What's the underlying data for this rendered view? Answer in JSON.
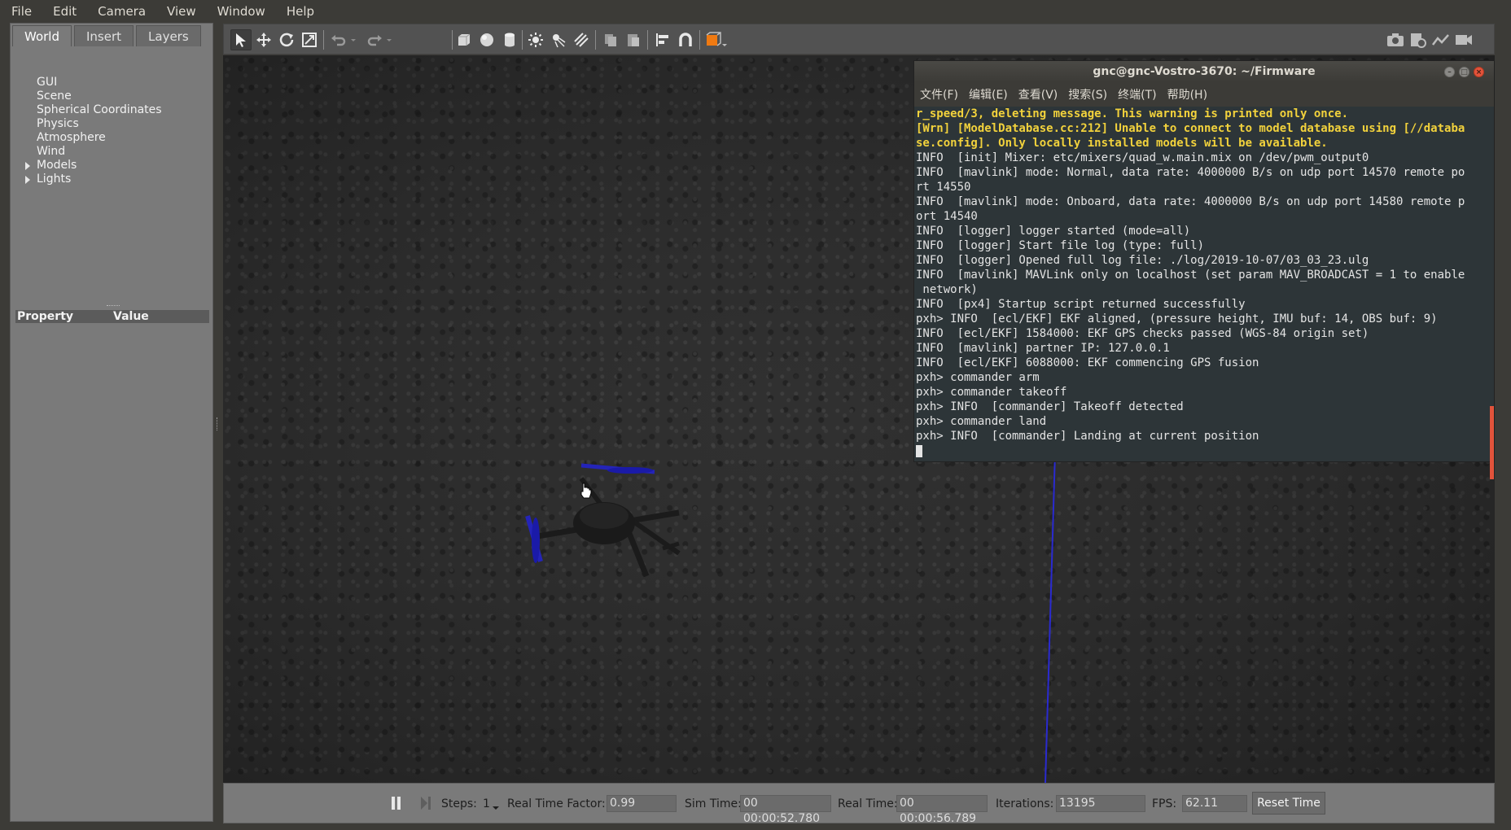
{
  "menubar": {
    "items": [
      "File",
      "Edit",
      "Camera",
      "View",
      "Window",
      "Help"
    ]
  },
  "left_panel": {
    "tabs": [
      "World",
      "Insert",
      "Layers"
    ],
    "active_tab": "World",
    "tree": [
      {
        "label": "GUI",
        "expandable": false
      },
      {
        "label": "Scene",
        "expandable": false
      },
      {
        "label": "Spherical Coordinates",
        "expandable": false
      },
      {
        "label": "Physics",
        "expandable": false
      },
      {
        "label": "Atmosphere",
        "expandable": false
      },
      {
        "label": "Wind",
        "expandable": false
      },
      {
        "label": "Models",
        "expandable": true
      },
      {
        "label": "Lights",
        "expandable": true
      }
    ],
    "property_header": {
      "property": "Property",
      "value": "Value"
    }
  },
  "toolbar": {
    "icons": [
      "select-arrow-icon",
      "translate-icon",
      "rotate-icon",
      "scale-icon",
      "undo-icon",
      "undo-dropdown-icon",
      "redo-icon",
      "redo-dropdown-icon",
      "box-shape-icon",
      "sphere-shape-icon",
      "cylinder-shape-icon",
      "point-light-icon",
      "spot-light-icon",
      "directional-light-icon",
      "copy-icon",
      "paste-icon",
      "align-icon",
      "snap-magnet-icon",
      "view-angle-icon",
      "screenshot-icon",
      "log-icon",
      "plot-icon",
      "video-record-icon"
    ]
  },
  "terminal": {
    "title": "gnc@gnc-Vostro-3670: ~/Firmware",
    "menus": [
      "文件(F)",
      "编辑(E)",
      "查看(V)",
      "搜索(S)",
      "终端(T)",
      "帮助(H)"
    ],
    "lines": [
      {
        "text": "r_speed/3, deleting message. This warning is printed only once.",
        "type": "warn"
      },
      {
        "text": "[Wrn] [ModelDatabase.cc:212] Unable to connect to model database using [//databa",
        "type": "warn"
      },
      {
        "text": "se.config]. Only locally installed models will be available.",
        "type": "warn"
      },
      {
        "text": "INFO  [init] Mixer: etc/mixers/quad_w.main.mix on /dev/pwm_output0",
        "type": "info"
      },
      {
        "text": "INFO  [mavlink] mode: Normal, data rate: 4000000 B/s on udp port 14570 remote po",
        "type": "info"
      },
      {
        "text": "rt 14550",
        "type": "info"
      },
      {
        "text": "INFO  [mavlink] mode: Onboard, data rate: 4000000 B/s on udp port 14580 remote p",
        "type": "info"
      },
      {
        "text": "ort 14540",
        "type": "info"
      },
      {
        "text": "INFO  [logger] logger started (mode=all)",
        "type": "info"
      },
      {
        "text": "INFO  [logger] Start file log (type: full)",
        "type": "info"
      },
      {
        "text": "INFO  [logger] Opened full log file: ./log/2019-10-07/03_03_23.ulg",
        "type": "info"
      },
      {
        "text": "INFO  [mavlink] MAVLink only on localhost (set param MAV_BROADCAST = 1 to enable",
        "type": "info"
      },
      {
        "text": " network)",
        "type": "info"
      },
      {
        "text": "INFO  [px4] Startup script returned successfully",
        "type": "info"
      },
      {
        "text": "pxh> INFO  [ecl/EKF] EKF aligned, (pressure height, IMU buf: 14, OBS buf: 9)",
        "type": "info"
      },
      {
        "text": "INFO  [ecl/EKF] 1584000: EKF GPS checks passed (WGS-84 origin set)",
        "type": "info"
      },
      {
        "text": "INFO  [mavlink] partner IP: 127.0.0.1",
        "type": "info"
      },
      {
        "text": "INFO  [ecl/EKF] 6088000: EKF commencing GPS fusion",
        "type": "info"
      },
      {
        "text": "pxh> commander arm",
        "type": "info"
      },
      {
        "text": "pxh> commander takeoff",
        "type": "info"
      },
      {
        "text": "pxh> INFO  [commander] Takeoff detected",
        "type": "info"
      },
      {
        "text": "pxh> commander land",
        "type": "info"
      },
      {
        "text": "pxh> INFO  [commander] Landing at current position",
        "type": "info"
      }
    ]
  },
  "statusbar": {
    "steps_label": "Steps:",
    "steps_value": "1",
    "rtf_label": "Real Time Factor:",
    "rtf_value": "0.99",
    "sim_time_label": "Sim Time:",
    "sim_time_value": "00 00:00:52.780",
    "real_time_label": "Real Time:",
    "real_time_value": "00 00:00:56.789",
    "iterations_label": "Iterations:",
    "iterations_value": "13195",
    "fps_label": "FPS:",
    "fps_value": "62.11",
    "reset_label": "Reset Time"
  },
  "colors": {
    "warning_text": "#f2d23c",
    "terminal_bg": "#2d3538",
    "propeller_blue": "#1a1aa8",
    "scrollbar_accent": "#e2533b"
  }
}
